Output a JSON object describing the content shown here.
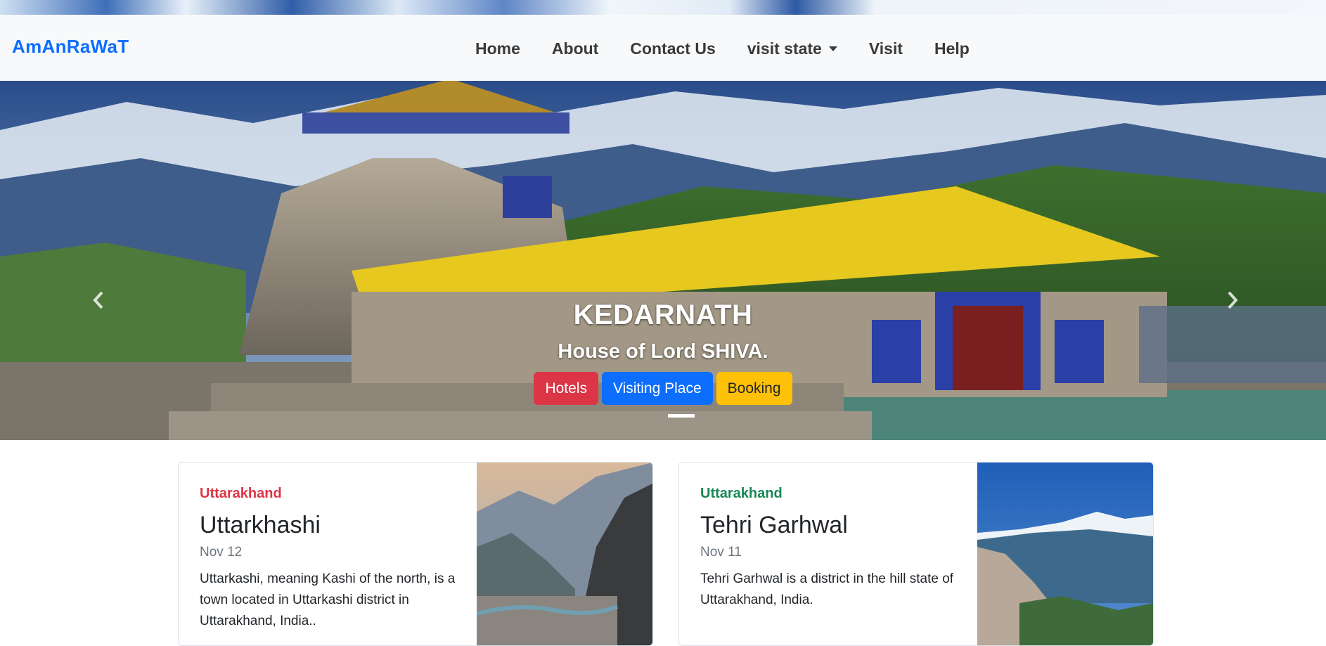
{
  "navbar": {
    "brand": "AmAnRaWaT",
    "links": [
      "Home",
      "About",
      "Contact Us",
      "visit state",
      "Visit",
      "Help"
    ]
  },
  "carousel": {
    "title": "KEDARNATH",
    "subtitle": "House of Lord SHIVA.",
    "buttons": [
      "Hotels",
      "Visiting Place",
      "Booking"
    ],
    "prev_icon": "chevron-left-icon",
    "next_icon": "chevron-right-icon"
  },
  "cards": [
    {
      "category": "Uttarakhand",
      "category_color": "#dc3545",
      "title": "Uttarkhashi",
      "date": "Nov 12",
      "text": "Uttarkashi, meaning Kashi of the north, is a town located in Uttarkashi district in Uttarakhand, India.."
    },
    {
      "category": "Uttarakhand",
      "category_color": "#198754",
      "title": "Tehri Garhwal",
      "date": "Nov 11",
      "text": "Tehri Garhwal is a district in the hill state of Uttarakhand, India."
    }
  ],
  "colors": {
    "brand": "#0d6efd",
    "navbar_bg": "#f8f9fa",
    "btn_hotels": "#dc3545",
    "btn_visiting": "#0d6efd",
    "btn_booking": "#ffc107"
  }
}
